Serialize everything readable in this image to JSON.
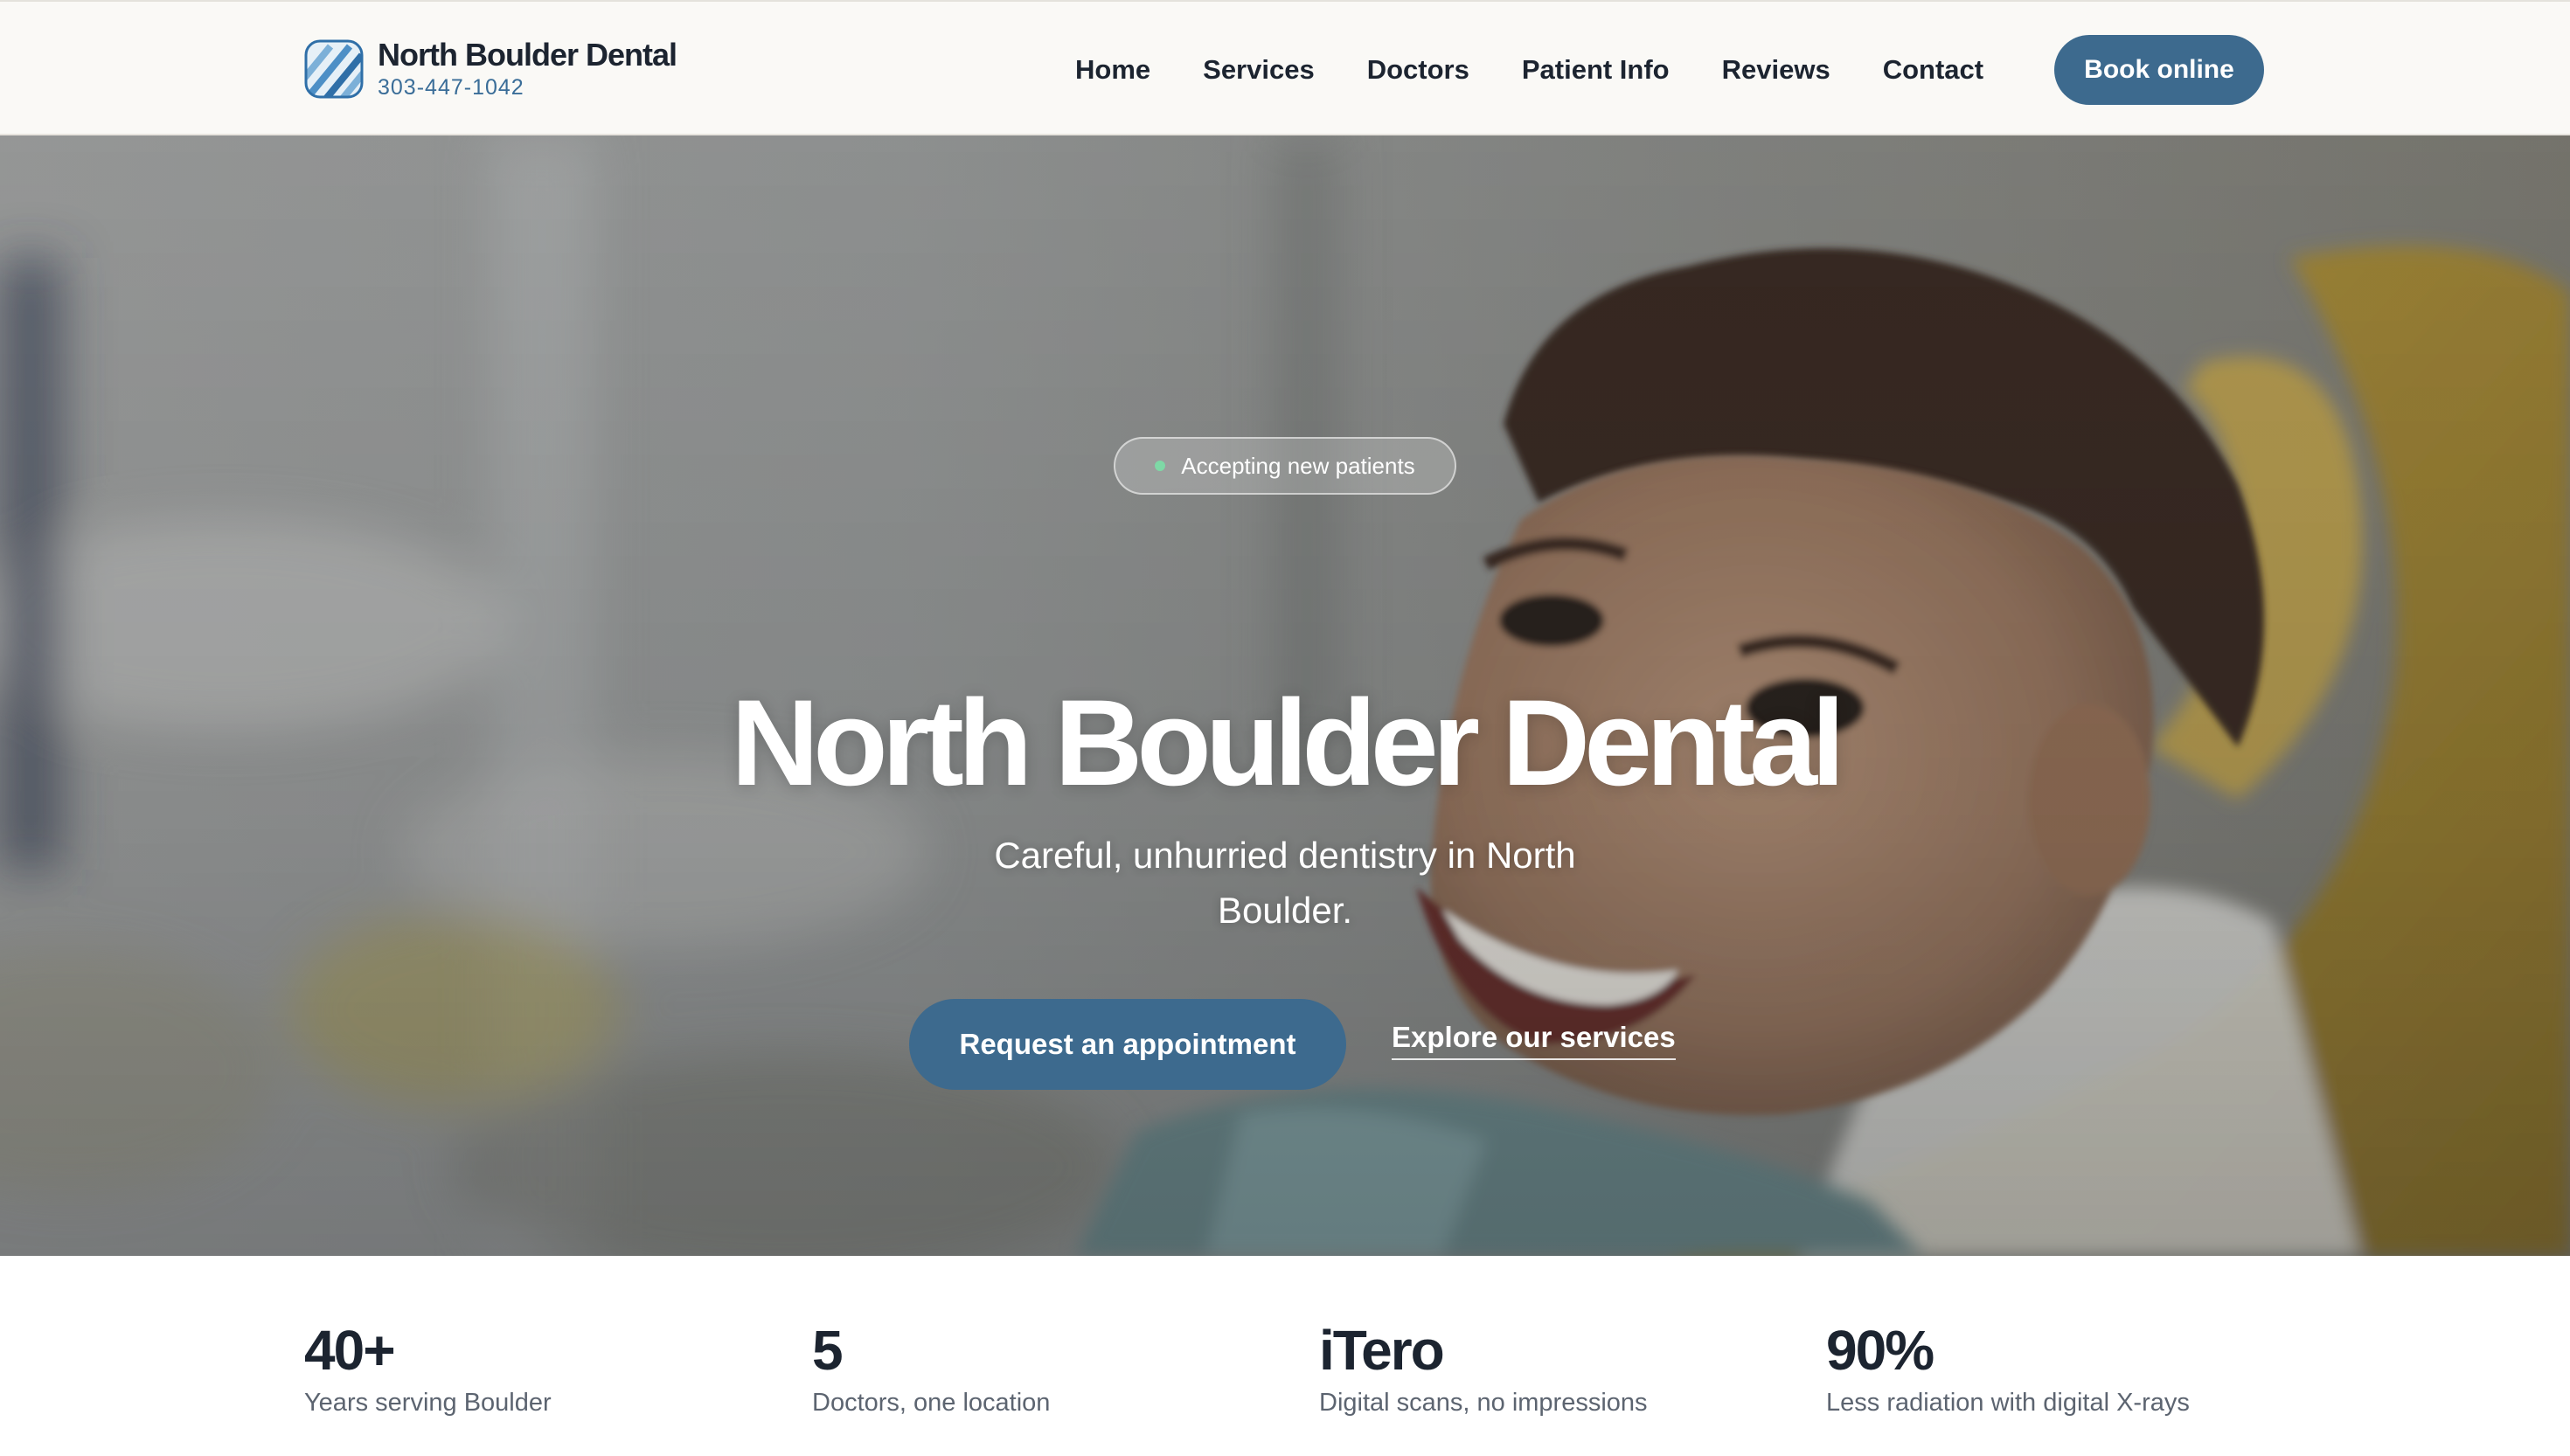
{
  "header": {
    "brand_name": "North Boulder Dental",
    "brand_phone": "303-447-1042",
    "logo_icon": "tooth-stripes-logo",
    "nav": [
      {
        "label": "Home"
      },
      {
        "label": "Services"
      },
      {
        "label": "Doctors"
      },
      {
        "label": "Patient Info"
      },
      {
        "label": "Reviews"
      },
      {
        "label": "Contact"
      }
    ],
    "cta_label": "Book online"
  },
  "hero": {
    "badge_label": "Accepting new patients",
    "title": "North Boulder Dental",
    "subtitle": "Careful, unhurried dentistry in North Boulder.",
    "primary_cta": "Request an appointment",
    "secondary_cta": "Explore our services",
    "photo": "smiling-boy-in-dental-chair"
  },
  "stats": [
    {
      "value": "40+",
      "label": "Years serving Boulder"
    },
    {
      "value": "5",
      "label": "Doctors, one location"
    },
    {
      "value": "iTero",
      "label": "Digital scans, no impressions"
    },
    {
      "value": "90%",
      "label": "Less radiation with digital X-rays"
    }
  ],
  "colors": {
    "accent": "#3d6a8e",
    "header_bg": "#faf9f6",
    "text_dark": "#1c2430",
    "phone": "#3a6d98",
    "status_dot": "#7ed9a6"
  }
}
